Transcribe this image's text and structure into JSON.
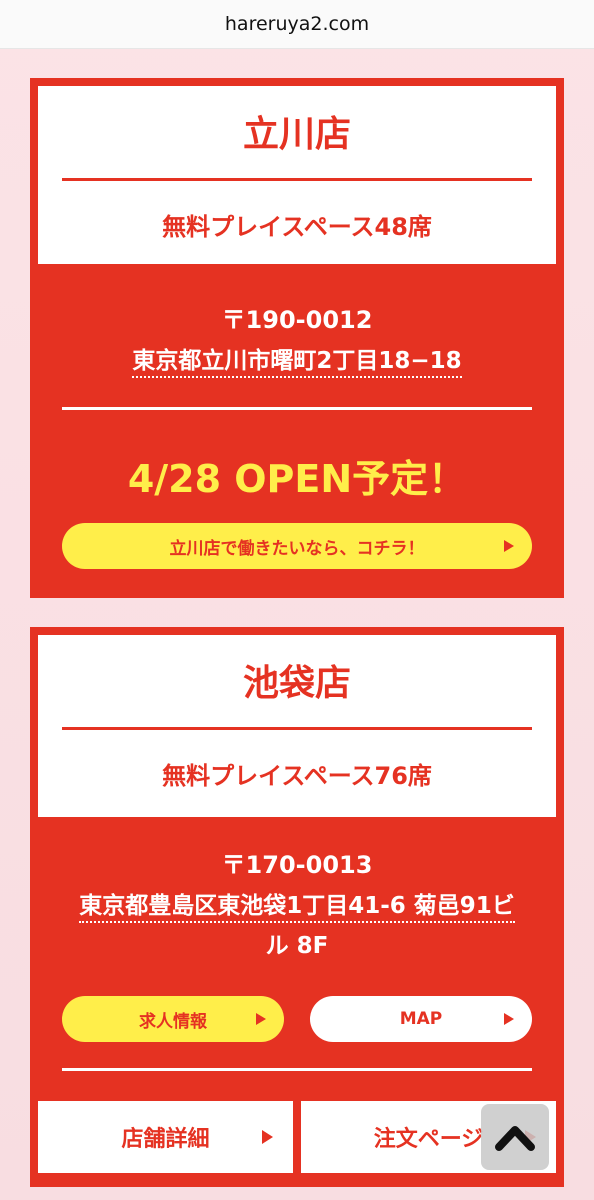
{
  "browser": {
    "url": "hareruya2.com"
  },
  "stores": [
    {
      "name": "立川店",
      "seats": "無料プレイスペース48席",
      "postal": "〒190-0012",
      "address": "東京都立川市曙町2丁目18−18",
      "open_notice": "4/28 OPEN予定！",
      "recruit_button": "立川店で働きたいなら、コチラ！"
    },
    {
      "name": "池袋店",
      "seats": "無料プレイスペース76席",
      "postal": "〒170-0013",
      "address_line1": "東京都豊島区東池袋1丁目41-6 菊邑91ビ",
      "address_line2": "ル 8F",
      "jobs_button": "求人情報",
      "map_button": "MAP",
      "details_button": "店舗詳細",
      "order_button": "注文ページ"
    }
  ],
  "icons": {
    "scroll_top": "chevron-up-icon",
    "arrow": "triangle-right-icon"
  },
  "colors": {
    "accent": "#e53222",
    "highlight": "#ffee4a",
    "background": "#f9e0e4"
  }
}
